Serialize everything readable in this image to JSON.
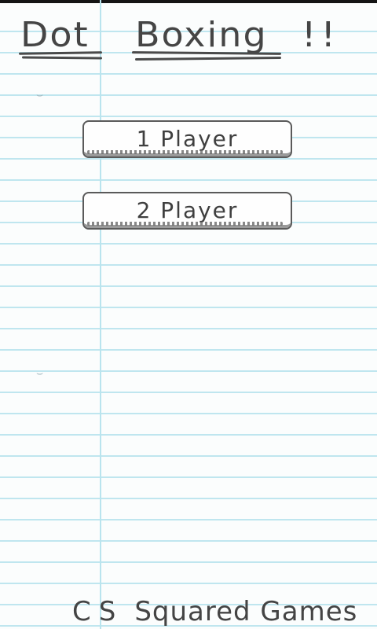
{
  "title": {
    "word1": "Dot",
    "word2": "Boxing",
    "exclaim": "!!"
  },
  "menu": {
    "one_player_label": "1 Player",
    "two_player_label": "2 Player"
  },
  "footer": {
    "brand_prefix": "CS",
    "brand_rest": "Squared Games"
  },
  "colors": {
    "paper": "#fbfdfd",
    "rule_line": "#bfe6ef",
    "margin_line": "#b9e4ee",
    "pencil": "#3a3a3a"
  }
}
